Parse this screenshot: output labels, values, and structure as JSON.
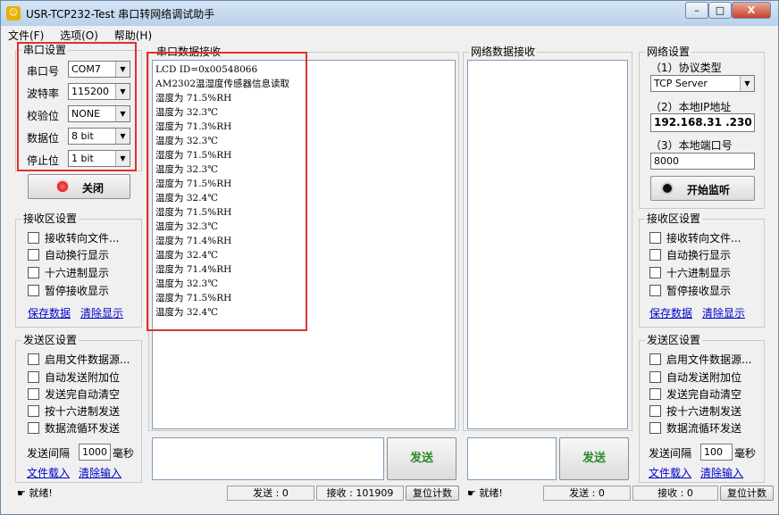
{
  "window": {
    "title": "USR-TCP232-Test 串口转网络调试助手",
    "minimize": "–",
    "maximize": "□",
    "close": "X"
  },
  "menu": [
    "文件(F)",
    "选项(O)",
    "帮助(H)"
  ],
  "serial_settings": {
    "title": "串口设置",
    "fields": [
      {
        "label": "串口号",
        "value": "COM7"
      },
      {
        "label": "波特率",
        "value": "115200"
      },
      {
        "label": "校验位",
        "value": "NONE"
      },
      {
        "label": "数据位",
        "value": "8 bit"
      },
      {
        "label": "停止位",
        "value": "1 bit"
      }
    ],
    "close_button": "关闭"
  },
  "left_recv_settings": {
    "title": "接收区设置",
    "checkboxes": [
      "接收转向文件...",
      "自动换行显示",
      "十六进制显示",
      "暂停接收显示"
    ],
    "save_link": "保存数据",
    "clear_link": "清除显示"
  },
  "left_send_settings": {
    "title": "发送区设置",
    "checkboxes": [
      "启用文件数据源...",
      "自动发送附加位",
      "发送完自动清空",
      "按十六进制发送",
      "数据流循环发送"
    ],
    "interval_label": "发送间隔",
    "interval_value": "1000",
    "interval_unit": "毫秒",
    "load_link": "文件载入",
    "clear_input_link": "清除输入"
  },
  "serial_recv": {
    "title": "串口数据接收",
    "lines": [
      "LCD ID=0x00548066",
      "AM2302温湿度传感器信息读取",
      "湿度为 71.5%RH",
      "温度为 32.3℃",
      "湿度为 71.3%RH",
      "温度为 32.3℃",
      "湿度为 71.5%RH",
      "温度为 32.3℃",
      "湿度为 71.5%RH",
      "温度为 32.4℃",
      "湿度为 71.5%RH",
      "温度为 32.3℃",
      "湿度为 71.4%RH",
      "温度为 32.4℃",
      "湿度为 71.4%RH",
      "温度为 32.3℃",
      "湿度为 71.5%RH",
      "温度为 32.4℃"
    ]
  },
  "net_recv": {
    "title": "网络数据接收"
  },
  "send_button": "发送",
  "net_settings": {
    "title": "网络设置",
    "protocol_label": "（1）协议类型",
    "protocol_value": "TCP Server",
    "ip_label": "（2）本地IP地址",
    "ip_value": "192.168.31 .230",
    "port_label": "（3）本地端口号",
    "port_value": "8000",
    "listen_button": "开始监听"
  },
  "right_recv_settings": {
    "title": "接收区设置",
    "checkboxes": [
      "接收转向文件...",
      "自动换行显示",
      "十六进制显示",
      "暂停接收显示"
    ],
    "save_link": "保存数据",
    "clear_link": "清除显示"
  },
  "right_send_settings": {
    "title": "发送区设置",
    "checkboxes": [
      "启用文件数据源...",
      "自动发送附加位",
      "发送完自动清空",
      "按十六进制发送",
      "数据流循环发送"
    ],
    "interval_label": "发送间隔",
    "interval_value": "100",
    "interval_unit": "毫秒",
    "load_link": "文件载入",
    "clear_input_link": "清除输入"
  },
  "status_left": {
    "ready": "就绪!",
    "sent": "发送 : 0",
    "received": "接收 : 101909",
    "reset": "复位计数"
  },
  "status_right": {
    "ready": "就绪!",
    "sent": "发送 : 0",
    "received": "接收 : 0",
    "reset": "复位计数"
  },
  "accent": {
    "highlight_border": "#e03030",
    "link": "#0000cc",
    "send_text": "#2a8a2a"
  }
}
